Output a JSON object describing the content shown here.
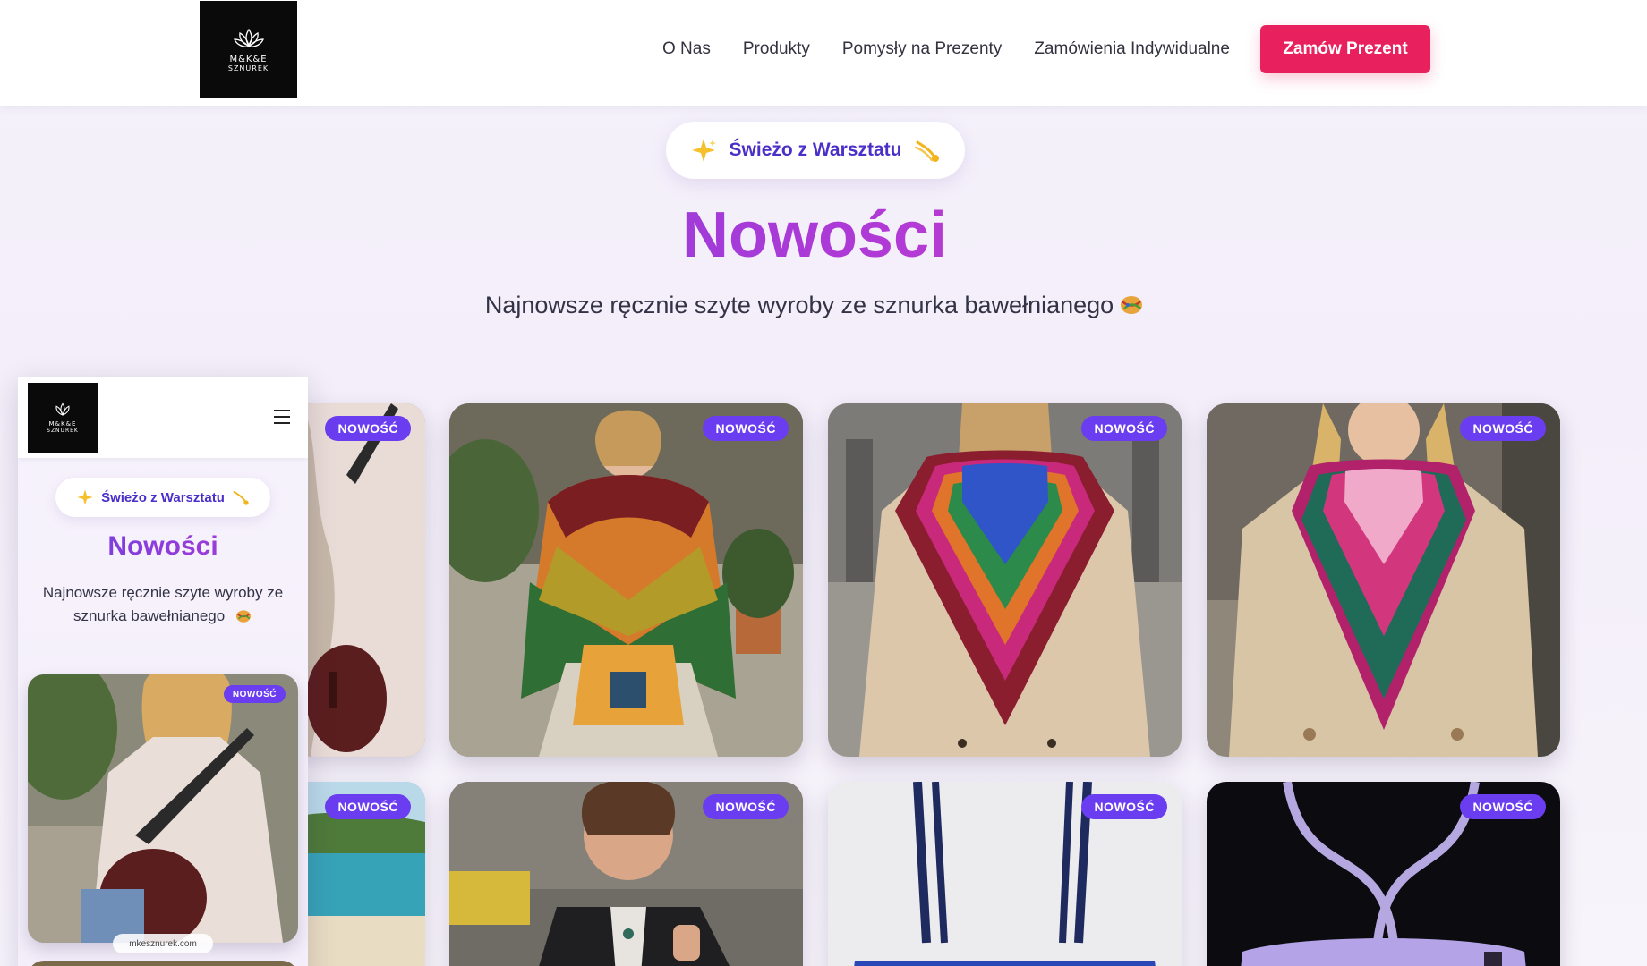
{
  "header": {
    "logo_line1": "M&K&E",
    "logo_line2": "SZNUREK",
    "nav": [
      "O Nas",
      "Produkty",
      "Pomysły na Prezenty",
      "Zamówienia Indywidualne"
    ],
    "cta_label": "Zamów Prezent"
  },
  "hero": {
    "pill_label": "Świeżo z Warsztatu",
    "title": "Nowości",
    "subtitle": "Najnowsze ręcznie szyte wyroby ze sznurka bawełnianego"
  },
  "badge_label": "NOWOŚĆ",
  "mobile": {
    "pill_label": "Świeżo z Warsztatu",
    "title": "Nowości",
    "subtitle": "Najnowsze ręcznie szyte wyroby ze sznurka bawełnianego",
    "url": "mkesznurek.com",
    "badge_label": "NOWOŚĆ"
  },
  "colors": {
    "accent_pink": "#e8215e",
    "badge_purple": "#6b3df0",
    "title_gradient_start": "#6a3fe0",
    "title_gradient_end": "#d8308f"
  }
}
